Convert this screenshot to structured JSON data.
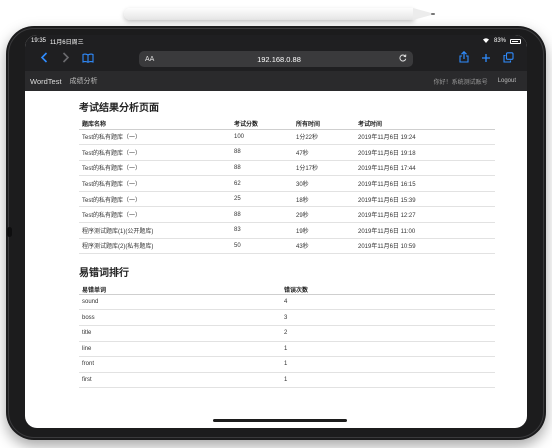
{
  "status": {
    "time": "19:35",
    "date": "11月6日周三",
    "battery": "83%"
  },
  "browser": {
    "text_size": "AA",
    "url": "192.168.0.88"
  },
  "icons": {
    "back": "chevron-left-icon",
    "forward": "chevron-right-icon",
    "bookmarks": "book-icon",
    "reload": "reload-icon",
    "share": "share-icon",
    "new_tab": "plus-icon",
    "tabs": "tabs-icon"
  },
  "site": {
    "brand": "WordTest",
    "nav_link": "成绩分析",
    "greeting": "你好！系统测试账号",
    "logout": "Logout"
  },
  "results": {
    "title": "考试结果分析页面",
    "columns": [
      "题库名称",
      "考试分数",
      "所有时间",
      "考试时间"
    ],
    "rows": [
      [
        "Test的私有题库（一）",
        "100",
        "1分22秒",
        "2019年11月6日 19:24"
      ],
      [
        "Test的私有题库（一）",
        "88",
        "47秒",
        "2019年11月6日 19:18"
      ],
      [
        "Test的私有题库（一）",
        "88",
        "1分17秒",
        "2019年11月6日 17:44"
      ],
      [
        "Test的私有题库（一）",
        "62",
        "30秒",
        "2019年11月6日 16:15"
      ],
      [
        "Test的私有题库（一）",
        "25",
        "18秒",
        "2019年11月6日 15:39"
      ],
      [
        "Test的私有题库（一）",
        "88",
        "29秒",
        "2019年11月6日 12:27"
      ],
      [
        "程序测试题库(1)(公开题库)",
        "83",
        "19秒",
        "2019年11月6日 11:00"
      ],
      [
        "程序测试题库(2)(私有题库)",
        "50",
        "43秒",
        "2019年11月6日 10:59"
      ]
    ]
  },
  "mistakes": {
    "title": "易错词排行",
    "columns": [
      "易错单词",
      "错误次数"
    ],
    "rows": [
      [
        "sound",
        "4"
      ],
      [
        "boss",
        "3"
      ],
      [
        "title",
        "2"
      ],
      [
        "line",
        "1"
      ],
      [
        "front",
        "1"
      ],
      [
        "first",
        "1"
      ]
    ]
  },
  "colors": {
    "browser_chrome": "#1f1f21",
    "site_nav": "#2a2a2c",
    "accent": "#2f8cff"
  }
}
